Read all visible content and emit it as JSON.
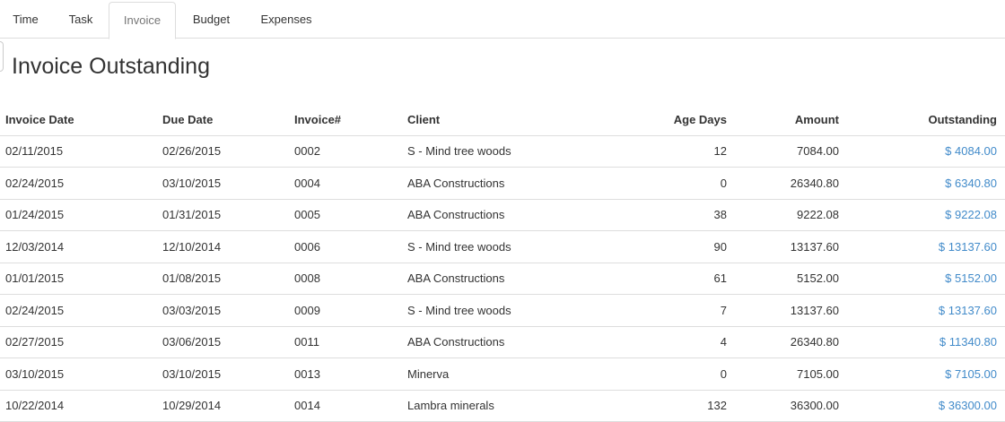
{
  "tabs": [
    {
      "label": "Time",
      "active": false
    },
    {
      "label": "Task",
      "active": false
    },
    {
      "label": "Invoice",
      "active": true
    },
    {
      "label": "Budget",
      "active": false
    },
    {
      "label": "Expenses",
      "active": false
    }
  ],
  "page_title": "Invoice Outstanding",
  "table": {
    "headers": [
      "Invoice Date",
      "Due Date",
      "Invoice#",
      "Client",
      "Age Days",
      "Amount",
      "Outstanding"
    ],
    "rows": [
      {
        "invoice_date": "02/11/2015",
        "due_date": "02/26/2015",
        "invoice_no": "0002",
        "client": "S - Mind tree woods",
        "age_days": "12",
        "amount": "7084.00",
        "outstanding": "$ 4084.00"
      },
      {
        "invoice_date": "02/24/2015",
        "due_date": "03/10/2015",
        "invoice_no": "0004",
        "client": "ABA Constructions",
        "age_days": "0",
        "amount": "26340.80",
        "outstanding": "$ 6340.80"
      },
      {
        "invoice_date": "01/24/2015",
        "due_date": "01/31/2015",
        "invoice_no": "0005",
        "client": "ABA Constructions",
        "age_days": "38",
        "amount": "9222.08",
        "outstanding": "$ 9222.08"
      },
      {
        "invoice_date": "12/03/2014",
        "due_date": "12/10/2014",
        "invoice_no": "0006",
        "client": "S - Mind tree woods",
        "age_days": "90",
        "amount": "13137.60",
        "outstanding": "$ 13137.60"
      },
      {
        "invoice_date": "01/01/2015",
        "due_date": "01/08/2015",
        "invoice_no": "0008",
        "client": "ABA Constructions",
        "age_days": "61",
        "amount": "5152.00",
        "outstanding": "$ 5152.00"
      },
      {
        "invoice_date": "02/24/2015",
        "due_date": "03/03/2015",
        "invoice_no": "0009",
        "client": "S - Mind tree woods",
        "age_days": "7",
        "amount": "13137.60",
        "outstanding": "$ 13137.60"
      },
      {
        "invoice_date": "02/27/2015",
        "due_date": "03/06/2015",
        "invoice_no": "0011",
        "client": "ABA Constructions",
        "age_days": "4",
        "amount": "26340.80",
        "outstanding": "$ 11340.80"
      },
      {
        "invoice_date": "03/10/2015",
        "due_date": "03/10/2015",
        "invoice_no": "0013",
        "client": "Minerva",
        "age_days": "0",
        "amount": "7105.00",
        "outstanding": "$ 7105.00"
      },
      {
        "invoice_date": "10/22/2014",
        "due_date": "10/29/2014",
        "invoice_no": "0014",
        "client": "Lambra minerals",
        "age_days": "132",
        "amount": "36300.00",
        "outstanding": "$ 36300.00"
      }
    ]
  },
  "colors": {
    "link": "#428bca",
    "border": "#dddddd",
    "text": "#333333",
    "active_tab_text": "#777777"
  }
}
